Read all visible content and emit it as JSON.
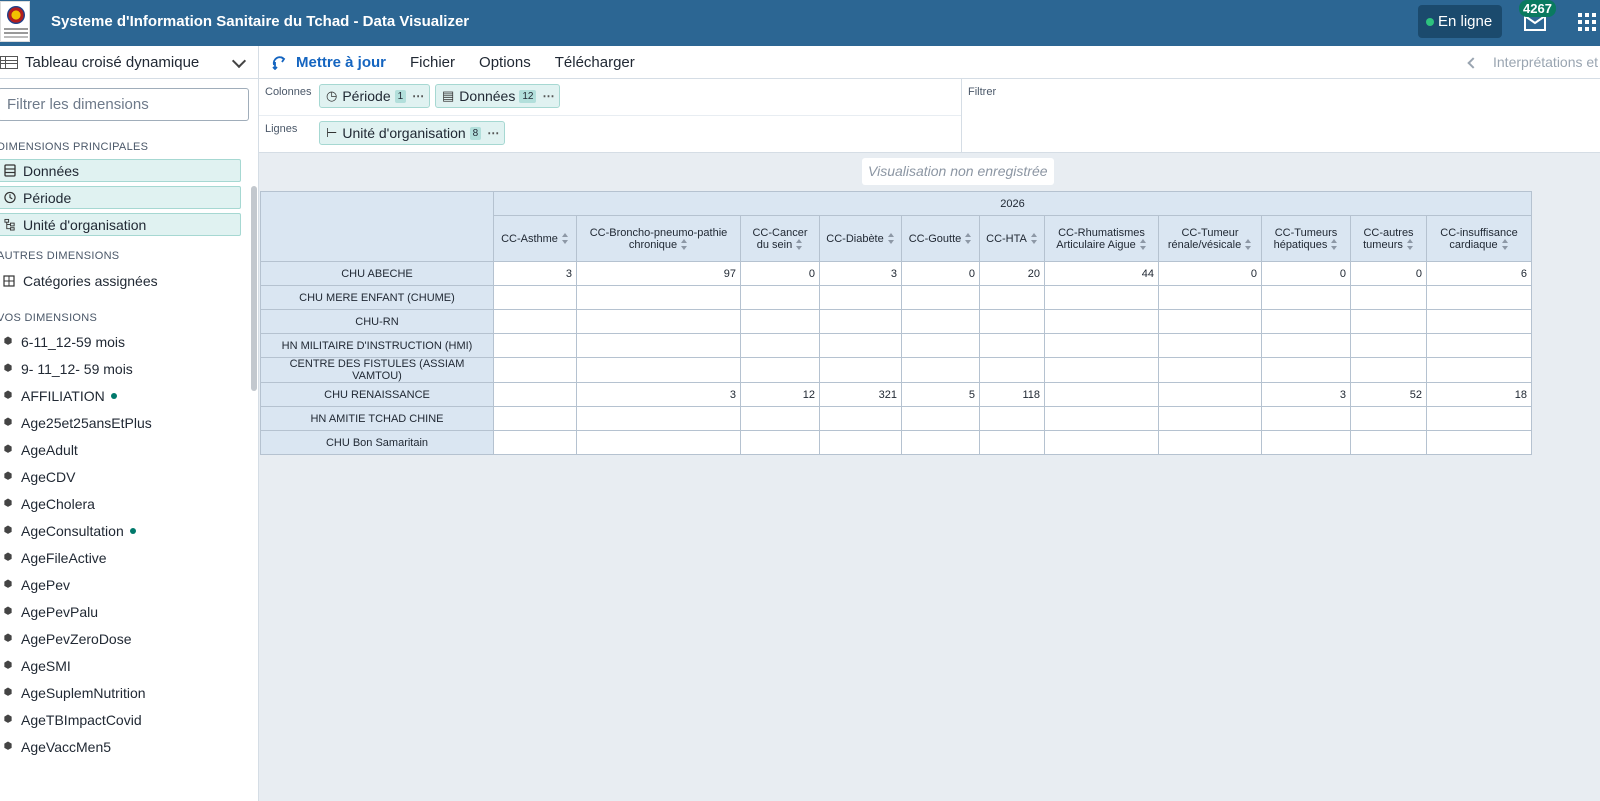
{
  "header": {
    "title": "Systeme d'Information Sanitaire du Tchad - Data Visualizer",
    "online_label": "En ligne",
    "mail_count": "4267"
  },
  "left_panel": {
    "vis_type": "Tableau croisé dynamique",
    "filter_placeholder": "Filtrer les dimensions",
    "main_heading": "DIMENSIONS PRINCIPALES",
    "main_dims": [
      "Données",
      "Période",
      "Unité d'organisation"
    ],
    "other_heading": "AUTRES DIMENSIONS",
    "other_dims": [
      "Catégories assignées"
    ],
    "your_heading": "VOS DIMENSIONS",
    "your_dims": [
      {
        "label": "6-11_12-59 mois",
        "dot": false
      },
      {
        "label": "9- 11_12- 59 mois",
        "dot": false
      },
      {
        "label": "AFFILIATION",
        "dot": true
      },
      {
        "label": "Age25et25ansEtPlus",
        "dot": false
      },
      {
        "label": "AgeAdult",
        "dot": false
      },
      {
        "label": "AgeCDV",
        "dot": false
      },
      {
        "label": "AgeCholera",
        "dot": false
      },
      {
        "label": "AgeConsultation",
        "dot": true
      },
      {
        "label": "AgeFileActive",
        "dot": false
      },
      {
        "label": "AgePev",
        "dot": false
      },
      {
        "label": "AgePevPalu",
        "dot": false
      },
      {
        "label": "AgePevZeroDose",
        "dot": false
      },
      {
        "label": "AgeSMI",
        "dot": false
      },
      {
        "label": "AgeSuplemNutrition",
        "dot": false
      },
      {
        "label": "AgeTBImpactCovid",
        "dot": false
      },
      {
        "label": "AgeVaccMen5",
        "dot": false
      }
    ]
  },
  "toolbar": {
    "update": "Mettre à jour",
    "file": "Fichier",
    "options": "Options",
    "download": "Télécharger",
    "interpretations": "Interprétations et"
  },
  "layout": {
    "columns_label": "Colonnes",
    "rows_label": "Lignes",
    "filter_label": "Filtrer",
    "period_chip": "Période",
    "period_count": "1",
    "data_chip": "Données",
    "data_count": "12",
    "org_chip": "Unité d'organisation",
    "org_count": "8"
  },
  "canvas": {
    "unsaved": "Visualisation non enregistrée"
  },
  "pivot": {
    "year": "2026",
    "columns": [
      "CC-Asthme",
      "CC-Broncho-pneumo-pathie chronique",
      "CC-Cancer du sein",
      "CC-Diabète",
      "CC-Goutte",
      "CC-HTA",
      "CC-Rhumatismes Articulaire Aigue",
      "CC-Tumeur rénale/vésicale",
      "CC-Tumeurs hépatiques",
      "CC-autres tumeurs",
      "CC-insuffisance cardiaque"
    ],
    "rows": [
      {
        "label": "CHU ABECHE",
        "values": [
          "3",
          "97",
          "0",
          "3",
          "0",
          "20",
          "44",
          "0",
          "0",
          "0",
          "6"
        ]
      },
      {
        "label": "CHU MERE ENFANT (CHUME)",
        "values": [
          "",
          "",
          "",
          "",
          "",
          "",
          "",
          "",
          "",
          "",
          ""
        ]
      },
      {
        "label": "CHU-RN",
        "values": [
          "",
          "",
          "",
          "",
          "",
          "",
          "",
          "",
          "",
          "",
          ""
        ]
      },
      {
        "label": "HN MILITAIRE D'INSTRUCTION (HMI)",
        "values": [
          "",
          "",
          "",
          "",
          "",
          "",
          "",
          "",
          "",
          "",
          ""
        ]
      },
      {
        "label": "CENTRE DES FISTULES (ASSIAM VAMTOU)",
        "values": [
          "",
          "",
          "",
          "",
          "",
          "",
          "",
          "",
          "",
          "",
          ""
        ]
      },
      {
        "label": "CHU RENAISSANCE",
        "values": [
          "",
          "3",
          "12",
          "321",
          "5",
          "118",
          "",
          "",
          "3",
          "52",
          "18"
        ]
      },
      {
        "label": "HN AMITIE TCHAD CHINE",
        "values": [
          "",
          "",
          "",
          "",
          "",
          "",
          "",
          "",
          "",
          "",
          ""
        ]
      },
      {
        "label": "CHU Bon Samaritain",
        "values": [
          "",
          "",
          "",
          "",
          "",
          "",
          "",
          "",
          "",
          "",
          ""
        ]
      }
    ]
  }
}
